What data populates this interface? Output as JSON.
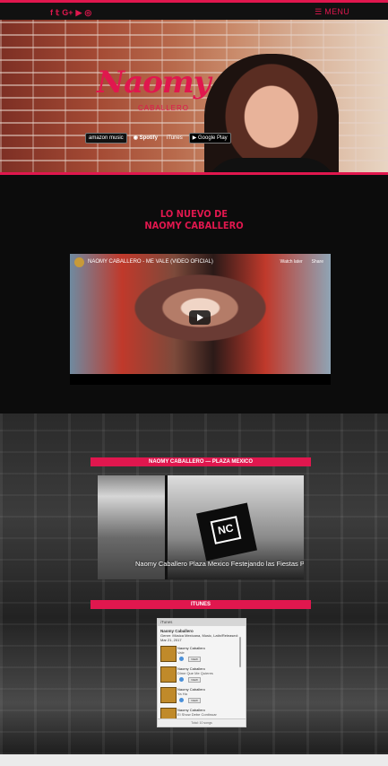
{
  "nav": {
    "social_icons": [
      {
        "name": "facebook-icon",
        "glyph": "f"
      },
      {
        "name": "twitter-icon",
        "glyph": "𝕥"
      },
      {
        "name": "google-plus-icon",
        "glyph": "G+"
      },
      {
        "name": "youtube-icon",
        "glyph": "▶"
      },
      {
        "name": "instagram-icon",
        "glyph": "◎"
      }
    ],
    "menu_label": "☰ MENU"
  },
  "hero": {
    "logo_script": "Naomy",
    "logo_sub": "CABALLERO",
    "badges": [
      {
        "name": "amazon-music-badge",
        "label": "amazon music"
      },
      {
        "name": "spotify-badge",
        "label": "◉ Spotify"
      },
      {
        "name": "itunes-badge",
        "label": " iTunes"
      },
      {
        "name": "google-play-badge",
        "label": "▶ Google Play"
      }
    ]
  },
  "news": {
    "heading_line1": "LO NUEVO DE",
    "heading_line2": "NAOMY CABALLERO"
  },
  "video": {
    "title": "NAOMY CABALLERO - ME VALE (VIDEO OFICIAL)",
    "watch_later": "Watch later",
    "share": "Share"
  },
  "gallery": {
    "band_title": "NAOMY CABALLERO — PLAZA MEXICO",
    "caption": "Naomy Caballero Plaza Mexico Festejando las Fiestas P",
    "shirt_logo": "NC"
  },
  "itunes": {
    "band_title": "ITUNES",
    "widget_header": "iTunes",
    "artist": "Naomy Caballero",
    "artist_meta": "Genre: Música Mexicana, Music, Latin/Released: Mar 21, 2017",
    "tracks": [
      {
        "artist": "Naomy Caballero",
        "title": "Vale",
        "button": "VIEW"
      },
      {
        "artist": "Naomy Caballero",
        "title": "Dime Que Me Quieres",
        "button": "VIEW"
      },
      {
        "artist": "Naomy Caballero",
        "title": "Ya Ha",
        "button": "VIEW"
      },
      {
        "artist": "Naomy Caballero",
        "title": "El Show Debe Continuar",
        "button": "VIEW"
      }
    ],
    "footer": "Total: 10 songs"
  },
  "colors": {
    "accent": "#e0174e",
    "background": "#0c0c0c"
  }
}
